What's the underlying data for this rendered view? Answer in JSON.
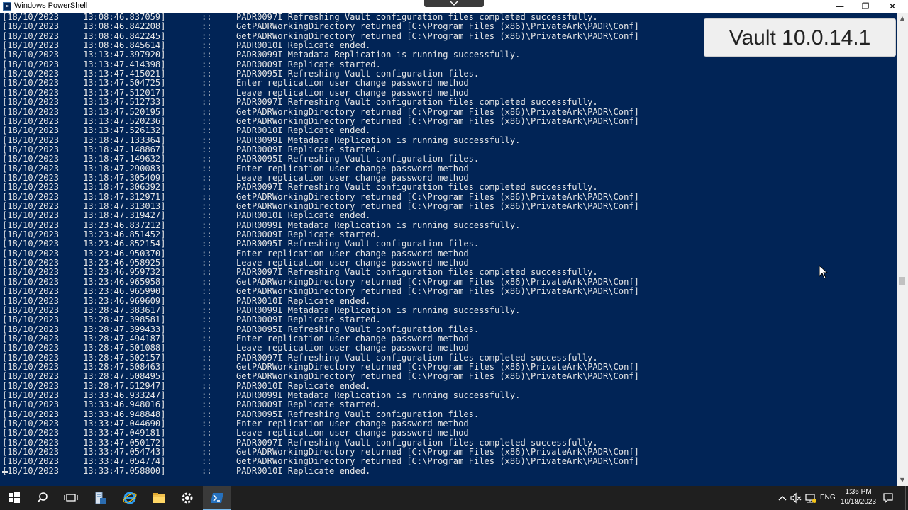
{
  "window": {
    "title": "Windows PowerShell",
    "minimize_glyph": "—",
    "maximize_glyph": "❐",
    "close_glyph": "✕",
    "icon": "powershell-icon"
  },
  "overlay": {
    "label": "Vault 10.0.14.1"
  },
  "console": {
    "lines": [
      {
        "date": "[18/10/2023",
        "time": "13:08:46.837059]",
        "sep": "::",
        "msg": "PADR0097I Refreshing Vault configuration files completed successfully."
      },
      {
        "date": "[18/10/2023",
        "time": "13:08:46.842208]",
        "sep": "::",
        "msg": "GetPADRWorkingDirectory returned [C:\\Program Files (x86)\\PrivateArk\\PADR\\Conf]"
      },
      {
        "date": "[18/10/2023",
        "time": "13:08:46.842245]",
        "sep": "::",
        "msg": "GetPADRWorkingDirectory returned [C:\\Program Files (x86)\\PrivateArk\\PADR\\Conf]"
      },
      {
        "date": "[18/10/2023",
        "time": "13:08:46.845614]",
        "sep": "::",
        "msg": "PADR0010I Replicate ended."
      },
      {
        "date": "[18/10/2023",
        "time": "13:13:47.397920]",
        "sep": "::",
        "msg": "PADR0099I Metadata Replication is running successfully."
      },
      {
        "date": "[18/10/2023",
        "time": "13:13:47.414398]",
        "sep": "::",
        "msg": "PADR0009I Replicate started."
      },
      {
        "date": "[18/10/2023",
        "time": "13:13:47.415021]",
        "sep": "::",
        "msg": "PADR0095I Refreshing Vault configuration files."
      },
      {
        "date": "[18/10/2023",
        "time": "13:13:47.504725]",
        "sep": "::",
        "msg": "Enter replication user change password method"
      },
      {
        "date": "[18/10/2023",
        "time": "13:13:47.512017]",
        "sep": "::",
        "msg": "Leave replication user change password method"
      },
      {
        "date": "[18/10/2023",
        "time": "13:13:47.512733]",
        "sep": "::",
        "msg": "PADR0097I Refreshing Vault configuration files completed successfully."
      },
      {
        "date": "[18/10/2023",
        "time": "13:13:47.520195]",
        "sep": "::",
        "msg": "GetPADRWorkingDirectory returned [C:\\Program Files (x86)\\PrivateArk\\PADR\\Conf]"
      },
      {
        "date": "[18/10/2023",
        "time": "13:13:47.520236]",
        "sep": "::",
        "msg": "GetPADRWorkingDirectory returned [C:\\Program Files (x86)\\PrivateArk\\PADR\\Conf]"
      },
      {
        "date": "[18/10/2023",
        "time": "13:13:47.526132]",
        "sep": "::",
        "msg": "PADR0010I Replicate ended."
      },
      {
        "date": "[18/10/2023",
        "time": "13:18:47.133364]",
        "sep": "::",
        "msg": "PADR0099I Metadata Replication is running successfully."
      },
      {
        "date": "[18/10/2023",
        "time": "13:18:47.148867]",
        "sep": "::",
        "msg": "PADR0009I Replicate started."
      },
      {
        "date": "[18/10/2023",
        "time": "13:18:47.149632]",
        "sep": "::",
        "msg": "PADR0095I Refreshing Vault configuration files."
      },
      {
        "date": "[18/10/2023",
        "time": "13:18:47.290083]",
        "sep": "::",
        "msg": "Enter replication user change password method"
      },
      {
        "date": "[18/10/2023",
        "time": "13:18:47.305409]",
        "sep": "::",
        "msg": "Leave replication user change password method"
      },
      {
        "date": "[18/10/2023",
        "time": "13:18:47.306392]",
        "sep": "::",
        "msg": "PADR0097I Refreshing Vault configuration files completed successfully."
      },
      {
        "date": "[18/10/2023",
        "time": "13:18:47.312971]",
        "sep": "::",
        "msg": "GetPADRWorkingDirectory returned [C:\\Program Files (x86)\\PrivateArk\\PADR\\Conf]"
      },
      {
        "date": "[18/10/2023",
        "time": "13:18:47.313013]",
        "sep": "::",
        "msg": "GetPADRWorkingDirectory returned [C:\\Program Files (x86)\\PrivateArk\\PADR\\Conf]"
      },
      {
        "date": "[18/10/2023",
        "time": "13:18:47.319427]",
        "sep": "::",
        "msg": "PADR0010I Replicate ended."
      },
      {
        "date": "[18/10/2023",
        "time": "13:23:46.837212]",
        "sep": "::",
        "msg": "PADR0099I Metadata Replication is running successfully."
      },
      {
        "date": "[18/10/2023",
        "time": "13:23:46.851452]",
        "sep": "::",
        "msg": "PADR0009I Replicate started."
      },
      {
        "date": "[18/10/2023",
        "time": "13:23:46.852154]",
        "sep": "::",
        "msg": "PADR0095I Refreshing Vault configuration files."
      },
      {
        "date": "[18/10/2023",
        "time": "13:23:46.950370]",
        "sep": "::",
        "msg": "Enter replication user change password method"
      },
      {
        "date": "[18/10/2023",
        "time": "13:23:46.958925]",
        "sep": "::",
        "msg": "Leave replication user change password method"
      },
      {
        "date": "[18/10/2023",
        "time": "13:23:46.959732]",
        "sep": "::",
        "msg": "PADR0097I Refreshing Vault configuration files completed successfully."
      },
      {
        "date": "[18/10/2023",
        "time": "13:23:46.965958]",
        "sep": "::",
        "msg": "GetPADRWorkingDirectory returned [C:\\Program Files (x86)\\PrivateArk\\PADR\\Conf]"
      },
      {
        "date": "[18/10/2023",
        "time": "13:23:46.965990]",
        "sep": "::",
        "msg": "GetPADRWorkingDirectory returned [C:\\Program Files (x86)\\PrivateArk\\PADR\\Conf]"
      },
      {
        "date": "[18/10/2023",
        "time": "13:23:46.969609]",
        "sep": "::",
        "msg": "PADR0010I Replicate ended."
      },
      {
        "date": "[18/10/2023",
        "time": "13:28:47.383617]",
        "sep": "::",
        "msg": "PADR0099I Metadata Replication is running successfully."
      },
      {
        "date": "[18/10/2023",
        "time": "13:28:47.398581]",
        "sep": "::",
        "msg": "PADR0009I Replicate started."
      },
      {
        "date": "[18/10/2023",
        "time": "13:28:47.399433]",
        "sep": "::",
        "msg": "PADR0095I Refreshing Vault configuration files."
      },
      {
        "date": "[18/10/2023",
        "time": "13:28:47.494187]",
        "sep": "::",
        "msg": "Enter replication user change password method"
      },
      {
        "date": "[18/10/2023",
        "time": "13:28:47.501088]",
        "sep": "::",
        "msg": "Leave replication user change password method"
      },
      {
        "date": "[18/10/2023",
        "time": "13:28:47.502157]",
        "sep": "::",
        "msg": "PADR0097I Refreshing Vault configuration files completed successfully."
      },
      {
        "date": "[18/10/2023",
        "time": "13:28:47.508463]",
        "sep": "::",
        "msg": "GetPADRWorkingDirectory returned [C:\\Program Files (x86)\\PrivateArk\\PADR\\Conf]"
      },
      {
        "date": "[18/10/2023",
        "time": "13:28:47.508495]",
        "sep": "::",
        "msg": "GetPADRWorkingDirectory returned [C:\\Program Files (x86)\\PrivateArk\\PADR\\Conf]"
      },
      {
        "date": "[18/10/2023",
        "time": "13:28:47.512947]",
        "sep": "::",
        "msg": "PADR0010I Replicate ended."
      },
      {
        "date": "[18/10/2023",
        "time": "13:33:46.933247]",
        "sep": "::",
        "msg": "PADR0099I Metadata Replication is running successfully."
      },
      {
        "date": "[18/10/2023",
        "time": "13:33:46.948016]",
        "sep": "::",
        "msg": "PADR0009I Replicate started."
      },
      {
        "date": "[18/10/2023",
        "time": "13:33:46.948848]",
        "sep": "::",
        "msg": "PADR0095I Refreshing Vault configuration files."
      },
      {
        "date": "[18/10/2023",
        "time": "13:33:47.044690]",
        "sep": "::",
        "msg": "Enter replication user change password method"
      },
      {
        "date": "[18/10/2023",
        "time": "13:33:47.049181]",
        "sep": "::",
        "msg": "Leave replication user change password method"
      },
      {
        "date": "[18/10/2023",
        "time": "13:33:47.050172]",
        "sep": "::",
        "msg": "PADR0097I Refreshing Vault configuration files completed successfully."
      },
      {
        "date": "[18/10/2023",
        "time": "13:33:47.054743]",
        "sep": "::",
        "msg": "GetPADRWorkingDirectory returned [C:\\Program Files (x86)\\PrivateArk\\PADR\\Conf]"
      },
      {
        "date": "[18/10/2023",
        "time": "13:33:47.054774]",
        "sep": "::",
        "msg": "GetPADRWorkingDirectory returned [C:\\Program Files (x86)\\PrivateArk\\PADR\\Conf]"
      },
      {
        "date": "[18/10/2023",
        "time": "13:33:47.058800]",
        "sep": "::",
        "msg": "PADR0010I Replicate ended."
      }
    ]
  },
  "taskbar": {
    "items": [
      "start-icon",
      "search-icon",
      "task-view-icon",
      "server-manager-icon",
      "internet-explorer-icon",
      "file-explorer-icon",
      "settings-gear-icon",
      "powershell-icon"
    ],
    "active_item": "powershell-icon",
    "tray": {
      "icons": [
        "chevron-up-icon",
        "volume-muted-icon",
        "network-icon"
      ],
      "language": "ENG",
      "time": "1:36 PM",
      "date": "10/18/2023",
      "notification_icon": "notification-icon"
    }
  },
  "colors": {
    "console_bg": "#012456",
    "console_text": "#e6e6e6",
    "taskbar_bg": "#1f1f1f",
    "accent": "#76b9ed"
  }
}
